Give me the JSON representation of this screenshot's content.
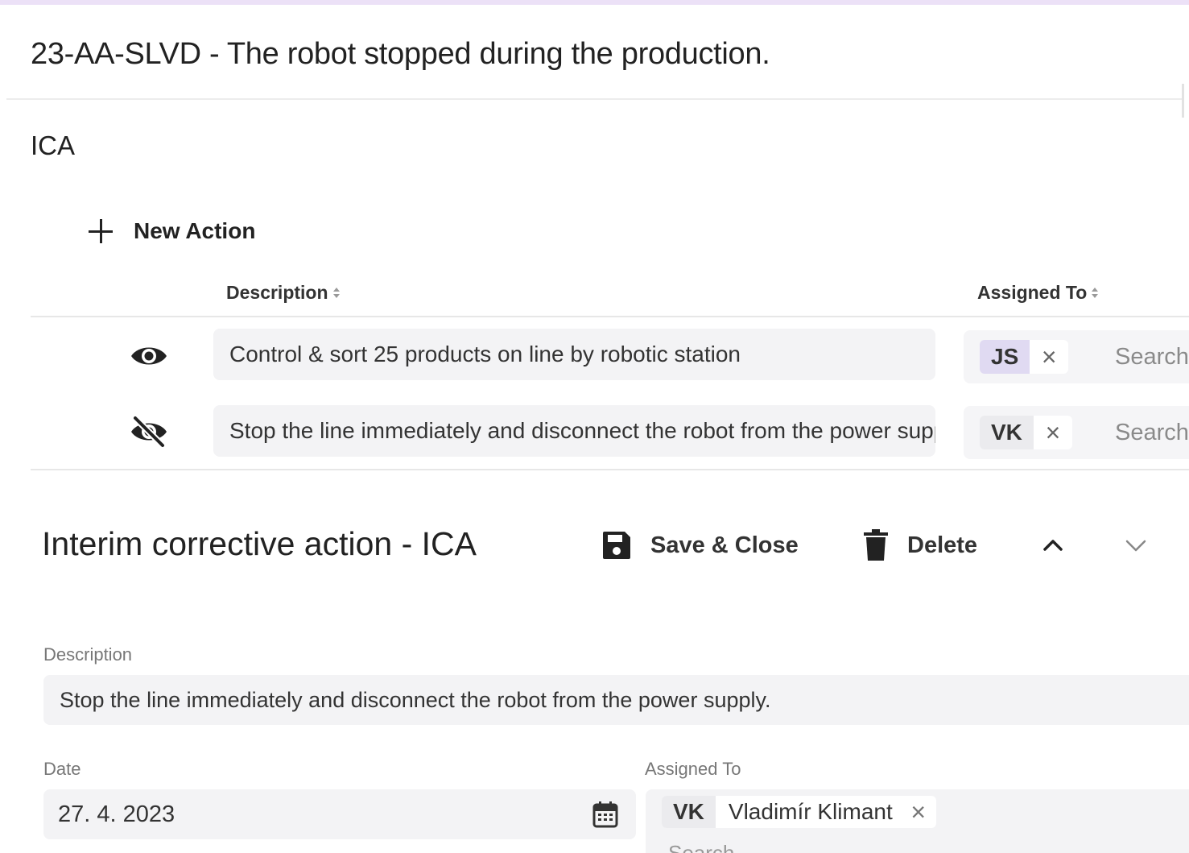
{
  "header": {
    "title": "23-AA-SLVD - The robot stopped during the production."
  },
  "section": {
    "label": "ICA"
  },
  "toolbar": {
    "new_action_label": "New Action"
  },
  "table": {
    "columns": [
      "Description",
      "Assigned To"
    ],
    "rows": [
      {
        "visible": true,
        "description": "Control & sort 25 products on line by robotic station",
        "assignee_initials": "JS",
        "chip_color": "#e0daf2",
        "search_placeholder": "Search"
      },
      {
        "visible": false,
        "description": "Stop the line immediately and disconnect the robot from the power supply.",
        "assignee_initials": "VK",
        "chip_color": "#ebebee",
        "search_placeholder": "Search"
      }
    ]
  },
  "detail": {
    "title": "Interim corrective action - ICA",
    "save_close_label": "Save & Close",
    "delete_label": "Delete",
    "description_label": "Description",
    "description_value": "Stop the line immediately and disconnect the robot from the power supply.",
    "date_label": "Date",
    "date_value": "27. 4. 2023",
    "assigned_label": "Assigned To",
    "assignee_initials": "VK",
    "assignee_name": "Vladimír Klimant",
    "search_placeholder": "Search"
  },
  "colors": {
    "accent": "#ece1f7",
    "field_bg": "#f3f3f5"
  }
}
